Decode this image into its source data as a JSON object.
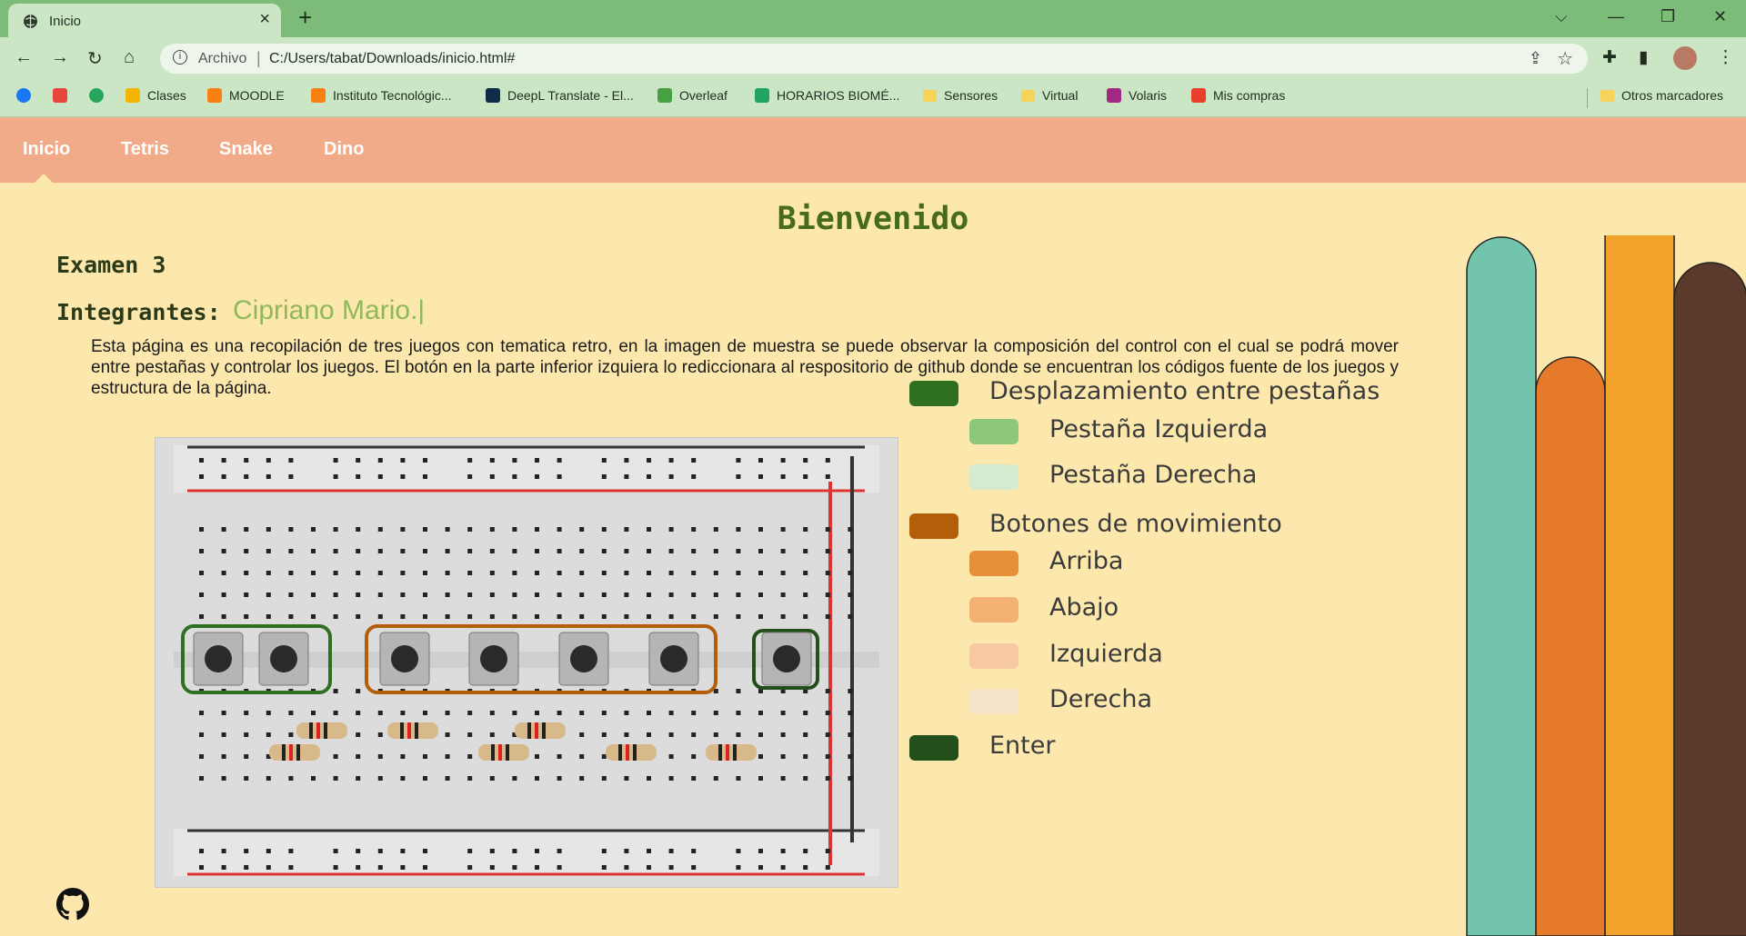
{
  "browser": {
    "tab_title": "Inicio",
    "url_scheme": "Archivo",
    "url": "C:/Users/tabat/Downloads/inicio.html#",
    "bookmarks": [
      {
        "label": "",
        "icon": "facebook-icon",
        "color": "#1877f2"
      },
      {
        "label": "",
        "icon": "apps-grid-icon",
        "color": "#e8453c"
      },
      {
        "label": "",
        "icon": "counter-icon",
        "color": "#26a65b"
      },
      {
        "label": "Clases",
        "icon": "classroom-icon",
        "color": "#f4b400"
      },
      {
        "label": "MOODLE",
        "icon": "moodle-icon",
        "color": "#f98012"
      },
      {
        "label": "Instituto Tecnológic...",
        "icon": "moodle-icon",
        "color": "#f98012"
      },
      {
        "label": "DeepL Translate - El...",
        "icon": "deepl-icon",
        "color": "#0f2b46"
      },
      {
        "label": "Overleaf",
        "icon": "overleaf-icon",
        "color": "#47a141"
      },
      {
        "label": "HORARIOS BIOMÉ...",
        "icon": "drive-icon",
        "color": "#1fa463"
      },
      {
        "label": "Sensores",
        "icon": "folder-icon",
        "color": "#f7d35a"
      },
      {
        "label": "Virtual",
        "icon": "folder-icon",
        "color": "#f7d35a"
      },
      {
        "label": "Volaris",
        "icon": "volaris-icon",
        "color": "#a12885"
      },
      {
        "label": "Mis compras",
        "icon": "flame-icon",
        "color": "#e8402b"
      }
    ],
    "other_bookmarks": "Otros marcadores"
  },
  "nav": {
    "items": [
      "Inicio",
      "Tetris",
      "Snake",
      "Dino"
    ]
  },
  "main": {
    "title": "Bienvenido",
    "exam": "Examen 3",
    "team_label": "Integrantes:",
    "team_names": "Cipriano Mario.|",
    "description": "Esta página es una recopilación de tres juegos con tematica retro, en la imagen de muestra se puede observar la composición del control con el cual se podrá mover entre pestañas y controlar los juegos. El botón en la parte inferior izquiera lo rediccionara al respositorio de github donde se encuentran los códigos fuente de los juegos y estructura de la página."
  },
  "legend": [
    {
      "label": "Desplazamiento entre pestañas",
      "color": "#2e7020"
    },
    {
      "label": "Pestaña Izquierda",
      "color": "#8dc87a"
    },
    {
      "label": "Pestaña Derecha",
      "color": "#d4ebd0"
    },
    {
      "label": "Botones de movimiento",
      "color": "#b35f0a"
    },
    {
      "label": "Arriba",
      "color": "#e5913a"
    },
    {
      "label": "Abajo",
      "color": "#f3b173"
    },
    {
      "label": "Izquierda",
      "color": "#f7c9a3"
    },
    {
      "label": "Derecha",
      "color": "#f8e4cc"
    },
    {
      "label": "Enter",
      "color": "#23501a"
    }
  ],
  "theme": {
    "page_bg": "#fce8ad",
    "nav_bg": "#f2ab88",
    "title_color": "#466b1c",
    "bar_colors": [
      "#72c5ac",
      "#e57a2a",
      "#f2a22b",
      "#5b3a2c"
    ]
  }
}
